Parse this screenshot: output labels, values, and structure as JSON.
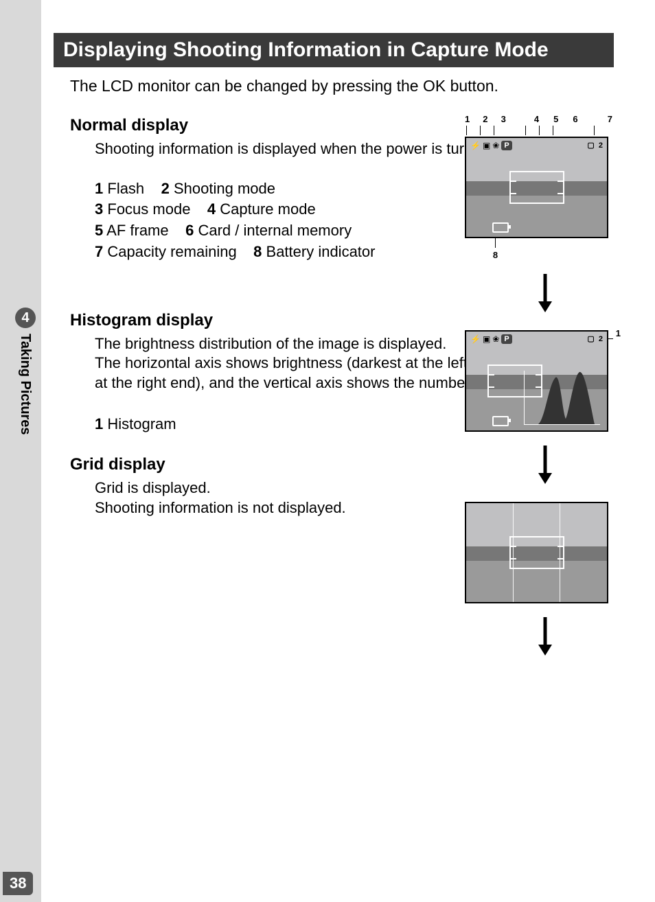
{
  "page_number": "38",
  "chapter": {
    "number": "4",
    "label": "Taking Pictures"
  },
  "title": "Displaying Shooting Information in Capture Mode",
  "intro": "The LCD monitor can be changed by pressing the OK button.",
  "callouts": {
    "top": [
      "1",
      "2",
      "3",
      "4",
      "5",
      "6",
      "7"
    ],
    "bottom": "8",
    "hist_side": "1"
  },
  "lcd_overlay": {
    "p_label": "P",
    "capacity": "2",
    "card_icon": "▢"
  },
  "normal": {
    "heading": "Normal display",
    "body": "Shooting information is displayed when the power is turned on.",
    "legend": [
      {
        "n": "1",
        "t": "Flash"
      },
      {
        "n": "2",
        "t": "Shooting mode"
      },
      {
        "n": "3",
        "t": "Focus mode"
      },
      {
        "n": "4",
        "t": "Capture mode"
      },
      {
        "n": "5",
        "t": "AF frame"
      },
      {
        "n": "6",
        "t": "Card / internal memory"
      },
      {
        "n": "7",
        "t": "Capacity remaining"
      },
      {
        "n": "8",
        "t": "Battery indicator"
      }
    ]
  },
  "histogram": {
    "heading": "Histogram display",
    "body": "The brightness distribution of the image is displayed.\nThe horizontal axis shows brightness (darkest at the left end and brightest at the right end), and the vertical axis shows the number of pixels.",
    "legend": [
      {
        "n": "1",
        "t": "Histogram"
      }
    ]
  },
  "grid": {
    "heading": "Grid display",
    "body": "Grid is displayed.\nShooting information is not displayed."
  }
}
